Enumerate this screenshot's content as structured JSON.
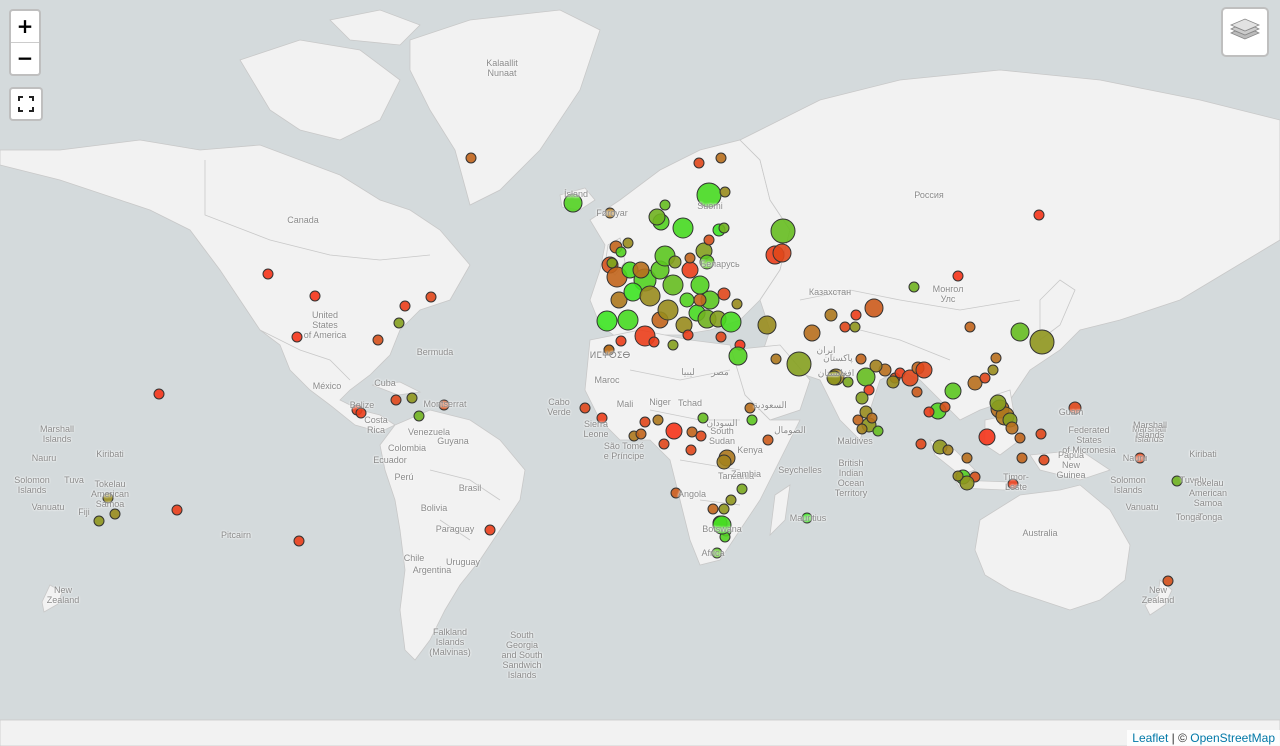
{
  "controls": {
    "zoom_in_label": "+",
    "zoom_out_label": "−",
    "layers_icon": "layers-icon",
    "fullscreen_icon": "fullscreen-icon"
  },
  "attribution": {
    "leaflet": "Leaflet",
    "separator": " | © ",
    "osm": "OpenStreetMap"
  },
  "colors": {
    "water": "#d4dadc",
    "land": "#f2f2f2",
    "border": "#c8c8c8",
    "marker_stroke": "#333333",
    "low": "#ff2a1a",
    "high": "#33ee22"
  },
  "labels": [
    {
      "text": "Kalaallit\nNunaat"
    },
    {
      "text": "Canada"
    },
    {
      "text": "United\nStates\nof America"
    },
    {
      "text": "Bermuda"
    },
    {
      "text": "México"
    },
    {
      "text": "Cuba"
    },
    {
      "text": "Belize"
    },
    {
      "text": "Costa\nRica"
    },
    {
      "text": "Montserrat"
    },
    {
      "text": "Venezuela"
    },
    {
      "text": "Guyana"
    },
    {
      "text": "Colombia"
    },
    {
      "text": "Ecuador"
    },
    {
      "text": "Perú"
    },
    {
      "text": "Brasil"
    },
    {
      "text": "Bolivia"
    },
    {
      "text": "Paraguay"
    },
    {
      "text": "Uruguay"
    },
    {
      "text": "Chile"
    },
    {
      "text": "Argentina"
    },
    {
      "text": "Falkland\nIslands\n(Malvinas)"
    },
    {
      "text": "South\nGeorgia\nand South\nSandwich\nIslands"
    },
    {
      "text": "Pitcairn"
    },
    {
      "text": "Marshall\nIslands"
    },
    {
      "text": "Nauru"
    },
    {
      "text": "Kiribati"
    },
    {
      "text": "Solomon\nIslands"
    },
    {
      "text": "Tuva"
    },
    {
      "text": "Tokelau\nAmerican\nSamoa"
    },
    {
      "text": "Vanuatu"
    },
    {
      "text": "Fiji"
    },
    {
      "text": "Tonga"
    },
    {
      "text": "New\nZealand"
    },
    {
      "text": "Ísland"
    },
    {
      "text": "Føroyar"
    },
    {
      "text": "Suomi"
    },
    {
      "text": "Россия"
    },
    {
      "text": "Беларусь"
    },
    {
      "text": "Казахстан"
    },
    {
      "text": "Монгол\nУлс"
    },
    {
      "text": "ⵍⵎⵖⵔⵉⴱ"
    },
    {
      "text": "Maroc"
    },
    {
      "text": "Mali"
    },
    {
      "text": "Niger"
    },
    {
      "text": "Tchad"
    },
    {
      "text": "ليبيا"
    },
    {
      "text": "مصر"
    },
    {
      "text": "السودان"
    },
    {
      "text": "السعودية"
    },
    {
      "text": "Cabo\nVerde"
    },
    {
      "text": "Sierra\nLeone"
    },
    {
      "text": "São Tomé\ne Príncipe"
    },
    {
      "text": "South\nSudan"
    },
    {
      "text": "Kenya"
    },
    {
      "text": "Tanzania"
    },
    {
      "text": "Angola"
    },
    {
      "text": "Zambia"
    },
    {
      "text": "Botswana"
    },
    {
      "text": "Africa"
    },
    {
      "text": "Seychelles"
    },
    {
      "text": "Mauritius"
    },
    {
      "text": "British\nIndian\nOcean\nTerritory"
    },
    {
      "text": "Maldives"
    },
    {
      "text": "ایران"
    },
    {
      "text": "پاکستان"
    },
    {
      "text": "افغانستان"
    },
    {
      "text": "الصومال"
    },
    {
      "text": "Australia"
    },
    {
      "text": "Papua\nNew\nGuinea"
    },
    {
      "text": "Federated\nStates\nof Micronesia"
    },
    {
      "text": "Guam"
    },
    {
      "text": "Timor-\nLeste"
    },
    {
      "text": "Marshall\nIslands"
    },
    {
      "text": "Nauru"
    },
    {
      "text": "Kiribati"
    },
    {
      "text": "Solomon\nIslands"
    },
    {
      "text": "Tuvalu"
    },
    {
      "text": "Tokelau\nAmerican\nSamoa"
    },
    {
      "text": "Vanuatu"
    },
    {
      "text": "Tonga"
    },
    {
      "text": "New\nZealand"
    },
    {
      "text": "Marshall\nIslands"
    }
  ],
  "markers_note_fields": [
    "score"
  ],
  "markers": [
    {
      "id": "greenland",
      "score": 0.3,
      "size": "s"
    },
    {
      "id": "iceland",
      "score": 0.85,
      "size": "m"
    },
    {
      "id": "faroe",
      "score": 0.4,
      "size": "s"
    },
    {
      "id": "norway-n1",
      "score": 0.15,
      "size": "s"
    },
    {
      "id": "norway-n2",
      "score": 0.35,
      "size": "s"
    },
    {
      "id": "sweden",
      "score": 0.9,
      "size": "l"
    },
    {
      "id": "finland",
      "score": 0.5,
      "size": "s"
    },
    {
      "id": "usa-nw",
      "score": 0.05,
      "size": "s"
    },
    {
      "id": "usa-mid",
      "score": 0.05,
      "size": "s"
    },
    {
      "id": "usa-sw",
      "score": 0.05,
      "size": "s"
    },
    {
      "id": "usa-ne1",
      "score": 0.1,
      "size": "s"
    },
    {
      "id": "usa-ne2",
      "score": 0.6,
      "size": "s"
    },
    {
      "id": "usa-ne3",
      "score": 0.15,
      "size": "s"
    },
    {
      "id": "usa-se",
      "score": 0.2,
      "size": "s"
    },
    {
      "id": "hawaii",
      "score": 0.05,
      "size": "s"
    },
    {
      "id": "centam1",
      "score": 0.1,
      "size": "s"
    },
    {
      "id": "centam2",
      "score": 0.1,
      "size": "s"
    },
    {
      "id": "carib1",
      "score": 0.15,
      "size": "s"
    },
    {
      "id": "carib2",
      "score": 0.55,
      "size": "s"
    },
    {
      "id": "carib3",
      "score": 0.7,
      "size": "s"
    },
    {
      "id": "carib4",
      "score": 0.2,
      "size": "s"
    },
    {
      "id": "brazil",
      "score": 0.1,
      "size": "s"
    },
    {
      "id": "pitcairn1",
      "score": 0.1,
      "size": "s"
    },
    {
      "id": "pitcairn2",
      "score": 0.1,
      "size": "s"
    },
    {
      "id": "pac1",
      "score": 0.55,
      "size": "s"
    },
    {
      "id": "pac2",
      "score": 0.5,
      "size": "s"
    },
    {
      "id": "pac3",
      "score": 0.5,
      "size": "s"
    },
    {
      "id": "europe-cluster",
      "score": 0.6,
      "size": "cluster"
    },
    {
      "id": "russia-w1",
      "score": 0.1,
      "size": "m"
    },
    {
      "id": "russia-w2",
      "score": 0.15,
      "size": "m"
    },
    {
      "id": "russia-e",
      "score": 0.05,
      "size": "s"
    },
    {
      "id": "russia-n",
      "score": 0.75,
      "size": "l"
    },
    {
      "id": "kazakh",
      "score": 0.25,
      "size": "m"
    },
    {
      "id": "mongolia",
      "score": 0.05,
      "size": "s"
    },
    {
      "id": "mongolia2",
      "score": 0.7,
      "size": "s"
    },
    {
      "id": "turkey",
      "score": 0.5,
      "size": "m"
    },
    {
      "id": "mideast",
      "score": 0.85,
      "size": "m"
    },
    {
      "id": "iran",
      "score": 0.6,
      "size": "l"
    },
    {
      "id": "india-cluster",
      "score": 0.4,
      "size": "cluster"
    },
    {
      "id": "china1",
      "score": 0.3,
      "size": "s"
    },
    {
      "id": "china2",
      "score": 0.75,
      "size": "m"
    },
    {
      "id": "japan",
      "score": 0.55,
      "size": "l"
    },
    {
      "id": "sea-cluster",
      "score": 0.45,
      "size": "cluster"
    },
    {
      "id": "africa-cluster",
      "score": 0.45,
      "size": "cluster"
    },
    {
      "id": "southafrica",
      "score": 0.9,
      "size": "m"
    },
    {
      "id": "mauritius",
      "score": 0.95,
      "size": "s"
    },
    {
      "id": "australia-n",
      "score": 0.1,
      "size": "s"
    },
    {
      "id": "pacific-e1",
      "score": 0.15,
      "size": "s"
    },
    {
      "id": "pacific-e2",
      "score": 0.7,
      "size": "s"
    },
    {
      "id": "newzealand",
      "score": 0.2,
      "size": "s"
    }
  ]
}
